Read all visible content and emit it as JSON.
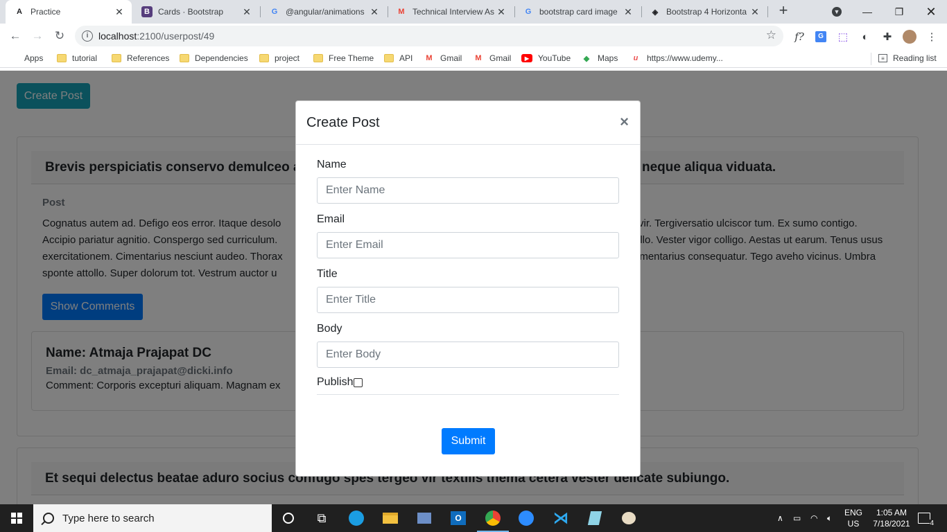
{
  "browser": {
    "tabs": [
      {
        "title": "Practice",
        "favicon": "angular-icon",
        "fav_glyph": "A",
        "fav_color": "#202124",
        "active": true
      },
      {
        "title": "Cards · Bootstrap",
        "favicon": "bootstrap-icon",
        "fav_glyph": "B",
        "fav_color": "#563d7c",
        "active": false
      },
      {
        "title": "@angular/animations",
        "favicon": "google-icon",
        "fav_glyph": "G",
        "fav_color": "#4285f4",
        "active": false
      },
      {
        "title": "Technical Interview As",
        "favicon": "gmail-icon",
        "fav_glyph": "M",
        "fav_color": "#ea4335",
        "active": false
      },
      {
        "title": "bootstrap card image",
        "favicon": "google-icon",
        "fav_glyph": "G",
        "fav_color": "#4285f4",
        "active": false
      },
      {
        "title": "Bootstrap 4 Horizonta",
        "favicon": "codeply-icon",
        "fav_glyph": "◈",
        "fav_color": "#202124",
        "active": false
      }
    ],
    "url_host": "localhost",
    "url_path": ":2100/userpost/49",
    "bookmarks": [
      {
        "label": "Apps",
        "icon": "apps-grid-icon"
      },
      {
        "label": "tutorial",
        "icon": "folder-icon"
      },
      {
        "label": "References",
        "icon": "folder-icon"
      },
      {
        "label": "Dependencies",
        "icon": "folder-icon"
      },
      {
        "label": "project",
        "icon": "folder-icon"
      },
      {
        "label": "Free Theme",
        "icon": "folder-icon"
      },
      {
        "label": "API",
        "icon": "folder-icon"
      },
      {
        "label": "Gmail",
        "icon": "gmail-icon"
      },
      {
        "label": "Gmail",
        "icon": "gmail-icon"
      },
      {
        "label": "YouTube",
        "icon": "youtube-icon"
      },
      {
        "label": "Maps",
        "icon": "maps-icon"
      },
      {
        "label": "https://www.udemy...",
        "icon": "udemy-icon"
      }
    ],
    "reading_list": "Reading list"
  },
  "page": {
    "create_post_button": "Create Post",
    "card1": {
      "title": "Brevis perspiciatis conservo demulceo a",
      "title_right": "neque aliqua viduata.",
      "post_label": "Post",
      "post_lines": [
        {
          "left": "Cognatus autem ad. Defigo eos error. Itaque desolo",
          "right": "vir. Tergiversatio ulciscor tum. Ex sumo contigo."
        },
        {
          "left": "Accipio pariatur agnitio. Conspergo sed curriculum.",
          "right": "illo. Vester vigor colligo. Aestas ut earum. Tenus usus"
        },
        {
          "left": "exercitationem. Cimentarius nesciunt audeo. Thorax",
          "right": "imentarius consequatur. Tego aveho vicinus. Umbra"
        },
        {
          "left": "sponte attollo. Super dolorum tot. Vestrum auctor u",
          "right": ""
        }
      ],
      "show_comments_button": "Show Comments",
      "comment": {
        "name": "Name: Atmaja Prajapat DC",
        "email": "Email: dc_atmaja_prajapat@dicki.info",
        "text": "Comment: Corporis excepturi aliquam. Magnam ex"
      }
    },
    "card2": {
      "title": "Et sequi delectus beatae aduro socius confugo spes tergeo vir textilis thema cetera vester delicate subiungo."
    }
  },
  "modal": {
    "title": "Create Post",
    "close": "×",
    "fields": [
      {
        "label": "Name",
        "placeholder": "Enter Name"
      },
      {
        "label": "Email",
        "placeholder": "Enter Email"
      },
      {
        "label": "Title",
        "placeholder": "Enter Title"
      },
      {
        "label": "Body",
        "placeholder": "Enter Body"
      }
    ],
    "publish_label": "Publish",
    "publish_checked": false,
    "submit": "Submit"
  },
  "taskbar": {
    "search_placeholder": "Type here to search",
    "lang_top": "ENG",
    "lang_bottom": "US",
    "time": "1:05 AM",
    "date": "7/18/2021",
    "notification_count": "4"
  },
  "colors": {
    "primary": "#007bff",
    "info": "#17a2b8",
    "backdrop": "rgba(0,0,0,0.5)"
  }
}
